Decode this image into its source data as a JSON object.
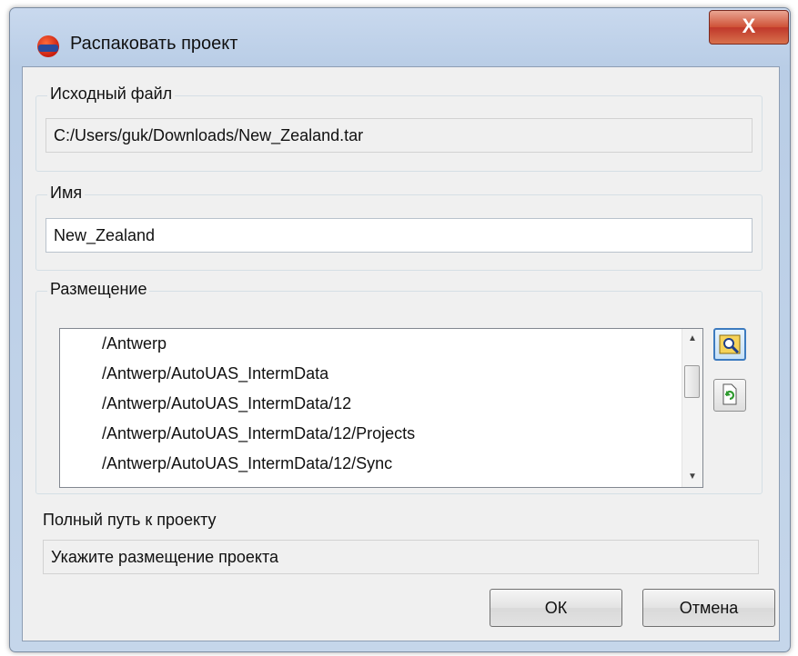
{
  "window": {
    "title": "Распаковать проект",
    "close_label": "X"
  },
  "source": {
    "legend": "Исходный файл",
    "value": "C:/Users/guk/Downloads/New_Zealand.tar"
  },
  "name": {
    "legend": "Имя",
    "value": "New_Zealand"
  },
  "placement": {
    "legend": "Размещение",
    "items": [
      "/Antwerp",
      "/Antwerp/AutoUAS_IntermData",
      "/Antwerp/AutoUAS_IntermData/12",
      "/Antwerp/AutoUAS_IntermData/12/Projects",
      "/Antwerp/AutoUAS_IntermData/12/Sync"
    ]
  },
  "full_path": {
    "label": "Полный путь к проекту",
    "value": "Укажите размещение проекта"
  },
  "buttons": {
    "ok": "ОК",
    "cancel": "Отмена"
  }
}
